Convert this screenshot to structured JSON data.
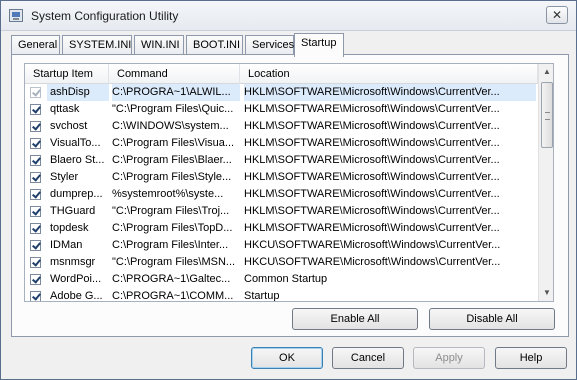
{
  "window": {
    "title": "System Configuration Utility",
    "close_glyph": "✕"
  },
  "tabs": [
    {
      "label": "General"
    },
    {
      "label": "SYSTEM.INI"
    },
    {
      "label": "WIN.INI"
    },
    {
      "label": "BOOT.INI"
    },
    {
      "label": "Services"
    },
    {
      "label": "Startup",
      "active": true
    }
  ],
  "table": {
    "columns": [
      "Startup Item",
      "Command",
      "Location"
    ],
    "rows": [
      {
        "item": "ashDisp",
        "command": "C:\\PROGRA~1\\ALWIL...",
        "location": "HKLM\\SOFTWARE\\Microsoft\\Windows\\CurrentVer...",
        "checked": true,
        "selected": true,
        "disabled": true
      },
      {
        "item": "qttask",
        "command": "\"C:\\Program Files\\Quic...",
        "location": "HKLM\\SOFTWARE\\Microsoft\\Windows\\CurrentVer...",
        "checked": true
      },
      {
        "item": "svchost",
        "command": "C:\\WINDOWS\\system...",
        "location": "HKLM\\SOFTWARE\\Microsoft\\Windows\\CurrentVer...",
        "checked": true
      },
      {
        "item": "VisualTo...",
        "command": "C:\\Program Files\\Visua...",
        "location": "HKLM\\SOFTWARE\\Microsoft\\Windows\\CurrentVer...",
        "checked": true
      },
      {
        "item": "Blaero St...",
        "command": "C:\\Program Files\\Blaer...",
        "location": "HKLM\\SOFTWARE\\Microsoft\\Windows\\CurrentVer...",
        "checked": true
      },
      {
        "item": "Styler",
        "command": "C:\\Program Files\\Style...",
        "location": "HKLM\\SOFTWARE\\Microsoft\\Windows\\CurrentVer...",
        "checked": true
      },
      {
        "item": "dumprep...",
        "command": "%systemroot%\\syste...",
        "location": "HKLM\\SOFTWARE\\Microsoft\\Windows\\CurrentVer...",
        "checked": true
      },
      {
        "item": "THGuard",
        "command": "\"C:\\Program Files\\Troj...",
        "location": "HKLM\\SOFTWARE\\Microsoft\\Windows\\CurrentVer...",
        "checked": true
      },
      {
        "item": "topdesk",
        "command": "C:\\Program Files\\TopD...",
        "location": "HKLM\\SOFTWARE\\Microsoft\\Windows\\CurrentVer...",
        "checked": true
      },
      {
        "item": "IDMan",
        "command": "C:\\Program Files\\Inter...",
        "location": "HKCU\\SOFTWARE\\Microsoft\\Windows\\CurrentVer...",
        "checked": true
      },
      {
        "item": "msnmsgr",
        "command": "\"C:\\Program Files\\MSN...",
        "location": "HKCU\\SOFTWARE\\Microsoft\\Windows\\CurrentVer...",
        "checked": true
      },
      {
        "item": "WordPoi...",
        "command": "C:\\PROGRA~1\\Galtec...",
        "location": "Common Startup",
        "checked": true
      },
      {
        "item": "Adobe G...",
        "command": "C:\\PROGRA~1\\COMM...",
        "location": "Startup",
        "checked": true
      }
    ]
  },
  "panel_buttons": {
    "enable_all": "Enable All",
    "disable_all": "Disable All"
  },
  "dialog_buttons": {
    "ok": "OK",
    "cancel": "Cancel",
    "apply": "Apply",
    "help": "Help"
  },
  "scrollbar": {
    "up_glyph": "▲",
    "down_glyph": "▼"
  }
}
